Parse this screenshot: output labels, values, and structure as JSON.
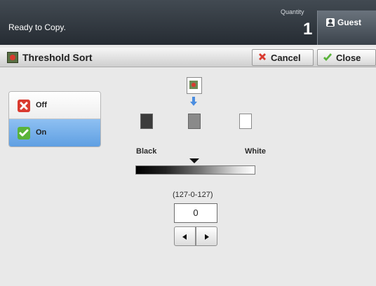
{
  "status_bar": {
    "status_text": "Ready to Copy.",
    "quantity_label": "Quantity",
    "quantity_value": "1",
    "user_label": "Guest"
  },
  "title_bar": {
    "title": "Threshold Sort",
    "cancel_label": "Cancel",
    "close_label": "Close"
  },
  "options": [
    {
      "label": "Off",
      "selected": false
    },
    {
      "label": "On",
      "selected": true
    }
  ],
  "threshold": {
    "left_label": "Black",
    "right_label": "White",
    "range_text": "(127-0-127)",
    "value": "0"
  },
  "icons": {
    "guest": "user-icon",
    "cancel": "red-x-icon",
    "close": "check-icon",
    "threshold_title": "threshold-sort-icon"
  },
  "colors": {
    "top_bar": "#2f353c",
    "selected_option": "#6aa8e8",
    "background": "#e9e9e9",
    "cancel_red": "#d93a2f",
    "check_green": "#59b33a"
  }
}
